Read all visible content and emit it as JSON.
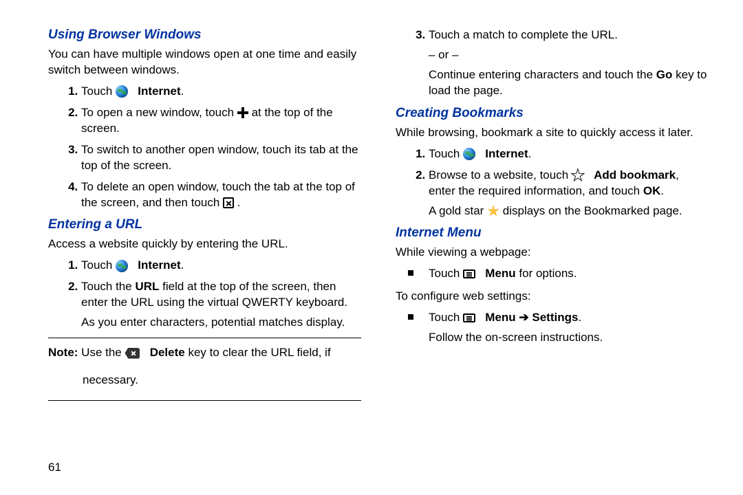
{
  "page_number": "61",
  "left": {
    "h1": "Using Browser Windows",
    "p1": "You can have multiple windows open at one time and easily switch between windows.",
    "s1": {
      "pre": "Touch ",
      "bold": "Internet",
      "post": "."
    },
    "s2": {
      "pre": "To open a new window, touch ",
      "post": " at the top of the screen."
    },
    "s3": "To switch to another open window, touch its tab at the top of the screen.",
    "s4": {
      "pre": "To delete an open window, touch the tab at the top of the screen, and then touch ",
      "post": " ."
    },
    "h2": "Entering a URL",
    "p2": "Access a website quickly by entering the URL.",
    "u1": {
      "pre": "Touch ",
      "bold": "Internet",
      "post": "."
    },
    "u2": {
      "pre": "Touch the ",
      "bold": "URL",
      "post": " field at the top of the screen, then enter the URL using the virtual QWERTY keyboard."
    },
    "u2b": "As you enter characters, potential matches display.",
    "note_pre": "Note: ",
    "note_mid1": "Use the ",
    "note_bold": "Delete",
    "note_mid2": " key to clear the URL field, if",
    "note_tail": "necessary."
  },
  "right": {
    "r3_a": "Touch a match to complete the URL.",
    "r3_or": "– or –",
    "r3_b_pre": "Continue entering characters and touch the ",
    "r3_b_bold": "Go",
    "r3_b_post": " key to load the page.",
    "h3": "Creating Bookmarks",
    "p3": "While browsing, bookmark a site to quickly access it later.",
    "b1": {
      "pre": "Touch ",
      "bold": "Internet",
      "post": "."
    },
    "b2": {
      "pre": "Browse to a website, touch ",
      "bold1": "Add bookmark",
      "mid": ", enter the required information, and touch ",
      "bold2": "OK",
      "post": "."
    },
    "b2b_pre": "A gold star ",
    "b2b_post": " displays on the Bookmarked page.",
    "h4": "Internet Menu",
    "p4": "While viewing a webpage:",
    "m1_pre": "Touch ",
    "m1_bold": "Menu",
    "m1_post": " for options.",
    "p5": "To configure web settings:",
    "m2_pre": "Touch ",
    "m2_bold1": "Menu",
    "m2_arrow": " ➔ ",
    "m2_bold2": "Settings",
    "m2_post": ".",
    "m2_tail": "Follow the on-screen instructions."
  }
}
